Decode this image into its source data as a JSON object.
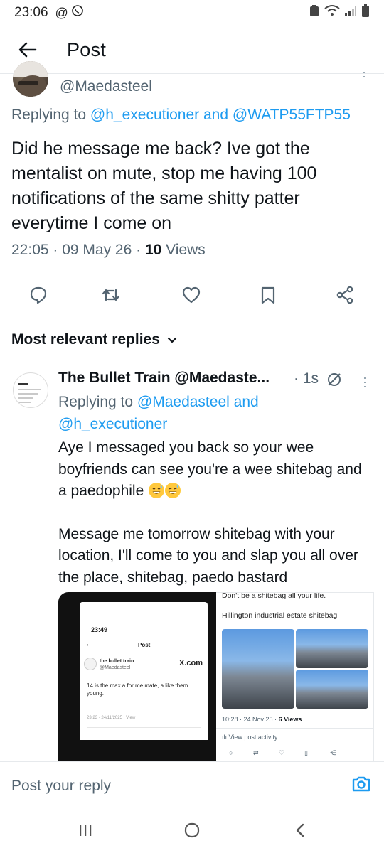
{
  "status_bar": {
    "time": "23:06"
  },
  "header": {
    "title": "Post"
  },
  "main_post": {
    "handle": "@Maedasteel",
    "replying_prefix": "Replying to",
    "replying_user1": "@h_executioner",
    "replying_and": "and",
    "replying_user2": "@WATP55FTP55",
    "text": "Did he message me back? Ive got the mentalist on mute, stop me having 100 notifications of the same shitty patter everytime I come on",
    "date_time": "22:05 · 09 May 26 ·",
    "views_count": "10",
    "views_label": "Views"
  },
  "replies_filter": {
    "label": "Most relevant replies"
  },
  "reply": {
    "name_handle": "The Bullet Train @Maedaste...",
    "time": "· 1s",
    "replying_prefix": "Replying to",
    "replying_user1": "@Maedasteel",
    "replying_and": "and",
    "replying_user2": "@h_executioner",
    "text_line1": "Aye I messaged you back so your wee boyfriends can see you're a wee shitebag and a paedophile",
    "text_line2": "Message me tomorrow shitebag  with your location, I'll come to you and slap you all over the place, shitebag, paedo bastard"
  },
  "attachment_left": {
    "time": "23:49",
    "title": "Post",
    "name": "the bullet train",
    "handle": "@Maedasteel",
    "brand": "X.com",
    "text": "14 is the max a for me mate,  a like them young.",
    "meta": "23:23 · 24/11/2025 · View"
  },
  "attachment_right": {
    "header": "Don't be a shitebag all your life.",
    "subtitle": "Hillington industrial estate shitebag",
    "meta_time": "10:28 · 24 Nov 25 ·",
    "meta_views": "6 Views",
    "activity": "View post activity"
  },
  "compose": {
    "placeholder": "Post your reply"
  },
  "colors": {
    "accent": "#1d9bf0",
    "secondary_text": "#536471",
    "primary_text": "#0f1419"
  },
  "icons": [
    "back-arrow-icon",
    "reply-icon",
    "repost-icon",
    "like-icon",
    "bookmark-icon",
    "share-icon",
    "chevron-down-icon",
    "grok-icon",
    "camera-icon",
    "recents-icon",
    "home-icon",
    "back-nav-icon"
  ]
}
